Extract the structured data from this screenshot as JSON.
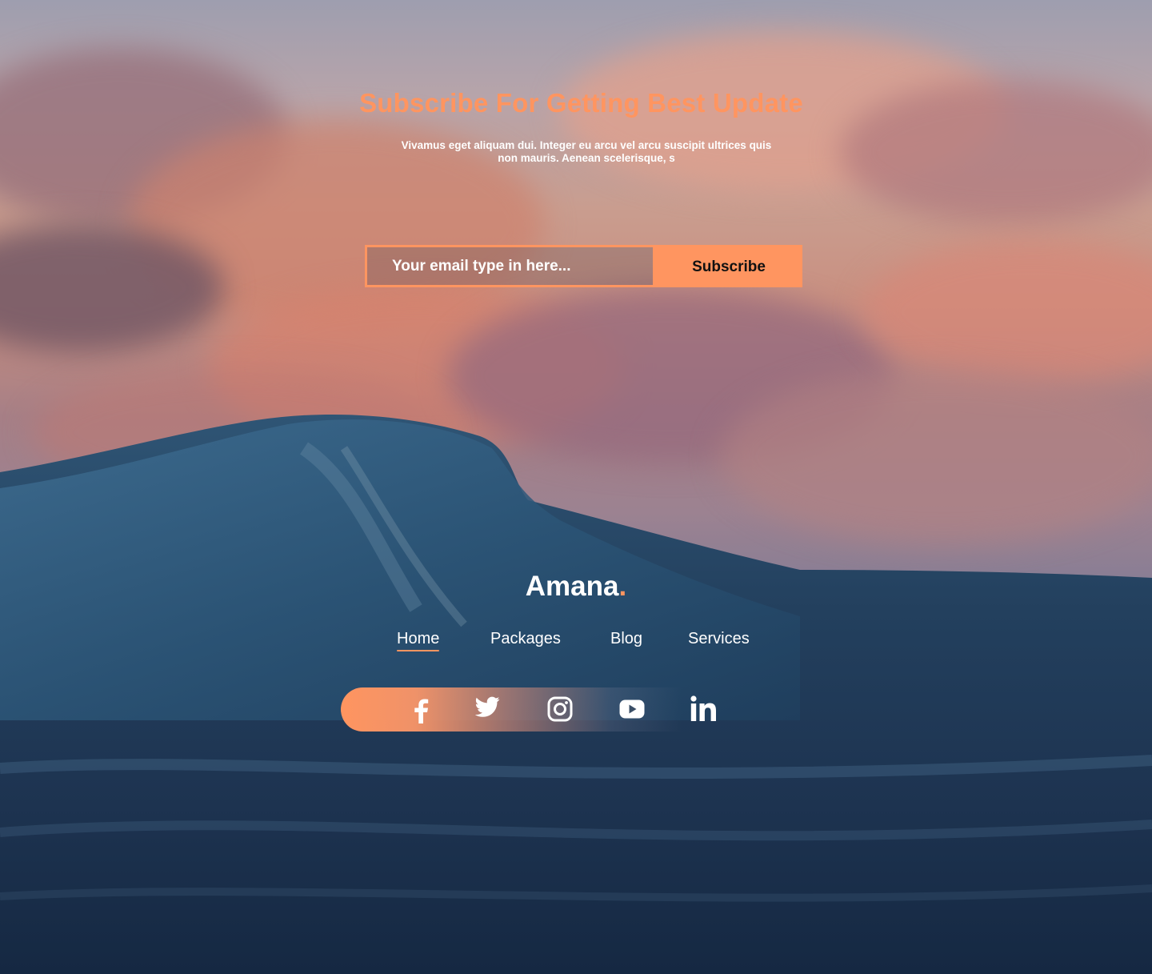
{
  "subscribe": {
    "title": "Subscribe For Getting Best Update",
    "description": "Vivamus eget aliquam dui. Integer eu arcu vel arcu suscipit ultrices quis non mauris. Aenean scelerisque, s",
    "email_placeholder": "Your email type in here...",
    "button_label": "Subscribe"
  },
  "footer": {
    "brand_name": "Amana",
    "brand_dot": ".",
    "nav": {
      "home": "Home",
      "packages": "Packages",
      "blog": "Blog",
      "services": "Services"
    },
    "active_nav": "Home",
    "social_icons": [
      "facebook-icon",
      "twitter-icon",
      "instagram-icon",
      "youtube-icon",
      "linkedin-icon"
    ]
  },
  "colors": {
    "accent": "#ff9560",
    "text": "#ffffff",
    "button_text": "#111111"
  }
}
